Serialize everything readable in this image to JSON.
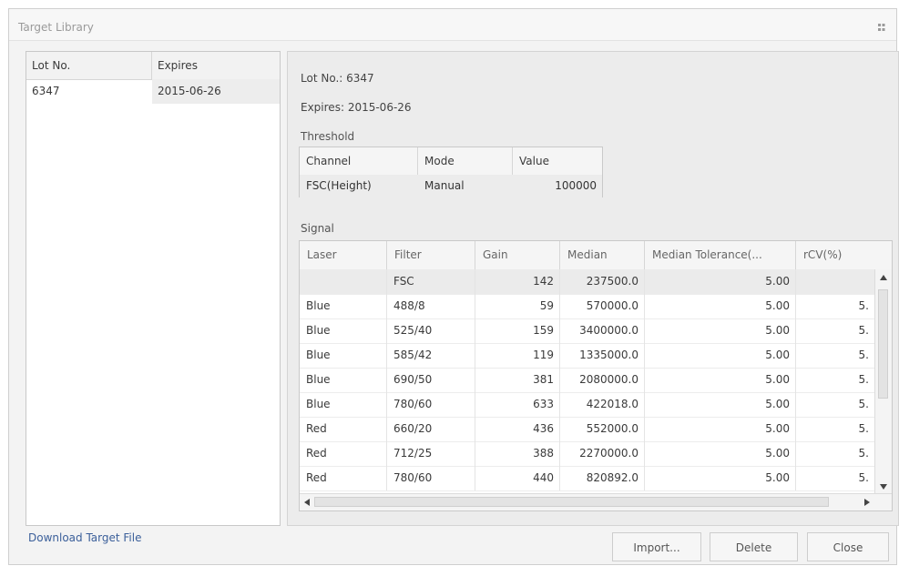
{
  "window": {
    "title": "Target Library"
  },
  "left_list": {
    "columns": [
      "Lot No.",
      "Expires"
    ],
    "rows": [
      {
        "lot": "6347",
        "expires": "2015-06-26"
      }
    ]
  },
  "details": {
    "lot_label": "Lot No.:",
    "lot_value": "6347",
    "expires_label": "Expires:",
    "expires_value": "2015-06-26",
    "threshold_title": "Threshold",
    "threshold_columns": [
      "Channel",
      "Mode",
      "Value"
    ],
    "threshold_row": {
      "channel": "FSC(Height)",
      "mode": "Manual",
      "value": "100000"
    },
    "signal_title": "Signal",
    "signal_columns": [
      "Laser",
      "Filter",
      "Gain",
      "Median",
      "Median Tolerance(...",
      "rCV(%)"
    ],
    "signal_rows": [
      {
        "laser": "",
        "filter": "FSC",
        "gain": "142",
        "median": "237500.0",
        "tol": "5.00",
        "rcv": ""
      },
      {
        "laser": "Blue",
        "filter": "488/8",
        "gain": "59",
        "median": "570000.0",
        "tol": "5.00",
        "rcv": "5."
      },
      {
        "laser": "Blue",
        "filter": "525/40",
        "gain": "159",
        "median": "3400000.0",
        "tol": "5.00",
        "rcv": "5."
      },
      {
        "laser": "Blue",
        "filter": "585/42",
        "gain": "119",
        "median": "1335000.0",
        "tol": "5.00",
        "rcv": "5."
      },
      {
        "laser": "Blue",
        "filter": "690/50",
        "gain": "381",
        "median": "2080000.0",
        "tol": "5.00",
        "rcv": "5."
      },
      {
        "laser": "Blue",
        "filter": "780/60",
        "gain": "633",
        "median": "422018.0",
        "tol": "5.00",
        "rcv": "5."
      },
      {
        "laser": "Red",
        "filter": "660/20",
        "gain": "436",
        "median": "552000.0",
        "tol": "5.00",
        "rcv": "5."
      },
      {
        "laser": "Red",
        "filter": "712/25",
        "gain": "388",
        "median": "2270000.0",
        "tol": "5.00",
        "rcv": "5."
      },
      {
        "laser": "Red",
        "filter": "780/60",
        "gain": "440",
        "median": "820892.0",
        "tol": "5.00",
        "rcv": "5."
      }
    ]
  },
  "footer": {
    "download_link": "Download Target File",
    "import_button": "Import...",
    "delete_button": "Delete",
    "close_button": "Close"
  },
  "icons": {
    "grip": "grip-icon",
    "scroll_up": "scroll-up-arrow-icon",
    "scroll_down": "scroll-down-arrow-icon",
    "scroll_left": "scroll-left-arrow-icon",
    "scroll_right": "scroll-right-arrow-icon"
  },
  "colors": {
    "link": "#3b5f9a",
    "selected_row": "#ebebeb",
    "background": "#f3f3f3"
  }
}
